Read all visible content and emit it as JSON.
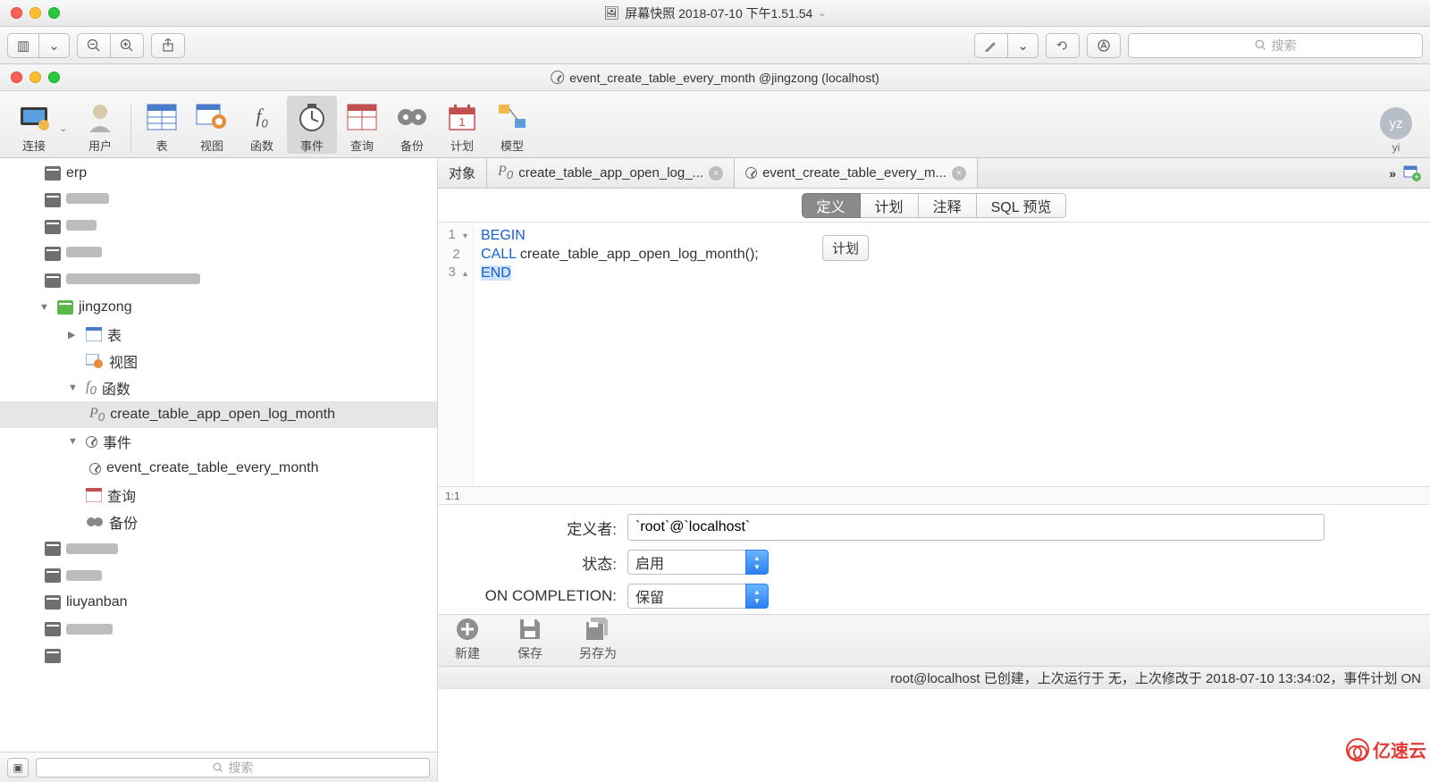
{
  "outer_window": {
    "title": "屏幕快照 2018-07-10 下午1.51.54",
    "search_placeholder": "搜索"
  },
  "navicat_window": {
    "title": "event_create_table_every_month @jingzong (localhost)"
  },
  "toolbar": {
    "items": [
      {
        "label": "连接",
        "icon": "connection"
      },
      {
        "label": "用户",
        "icon": "user"
      },
      {
        "label": "表",
        "icon": "table"
      },
      {
        "label": "视图",
        "icon": "view"
      },
      {
        "label": "函数",
        "icon": "function"
      },
      {
        "label": "事件",
        "icon": "event",
        "active": true
      },
      {
        "label": "查询",
        "icon": "query"
      },
      {
        "label": "备份",
        "icon": "backup"
      },
      {
        "label": "计划",
        "icon": "schedule"
      },
      {
        "label": "模型",
        "icon": "model"
      }
    ],
    "avatar": {
      "initials": "yz",
      "label": "yi"
    }
  },
  "sidebar": {
    "db_items": [
      {
        "label": "erp"
      },
      {
        "label": "fabao"
      },
      {
        "label": "bffc"
      },
      {
        "label": "hotel"
      },
      {
        "label": "information_schema"
      }
    ],
    "active_db": "jingzong",
    "child_nodes": {
      "table": "表",
      "view": "视图",
      "function": "函数",
      "function_item": "create_table_app_open_log_month",
      "event": "事件",
      "event_item": "event_create_table_every_month",
      "query": "查询",
      "backup": "备份"
    },
    "db_items_after": [
      {
        "label": "library"
      },
      {
        "label": "lizhi"
      },
      {
        "label": "liuyanban"
      },
      {
        "label": "ltd012"
      }
    ],
    "search_placeholder": "搜索"
  },
  "tabs": {
    "object": "对象",
    "func_tab": "create_table_app_open_log_...",
    "event_tab": "event_create_table_every_m..."
  },
  "subtabs": {
    "definition": "定义",
    "schedule": "计划",
    "comment": "注释",
    "sqlpreview": "SQL 预览"
  },
  "editor": {
    "lines": [
      "1",
      "2",
      "3"
    ],
    "code": {
      "l1": "BEGIN",
      "l2a": "CALL",
      "l2b": " create_table_app_open_log_month();",
      "l3": "END"
    },
    "tooltip": "计划",
    "cursor": "1:1"
  },
  "form": {
    "definer_label": "定义者:",
    "definer_value": "`root`@`localhost`",
    "status_label": "状态:",
    "status_value": "启用",
    "oncomp_label": "ON COMPLETION:",
    "oncomp_value": "保留"
  },
  "bottom_toolbar": {
    "new": "新建",
    "save": "保存",
    "saveas": "另存为"
  },
  "statusbar": "root@localhost 已创建，上次运行于 无，上次修改于 2018-07-10 13:34:02，事件计划 ON",
  "watermark": "亿速云"
}
